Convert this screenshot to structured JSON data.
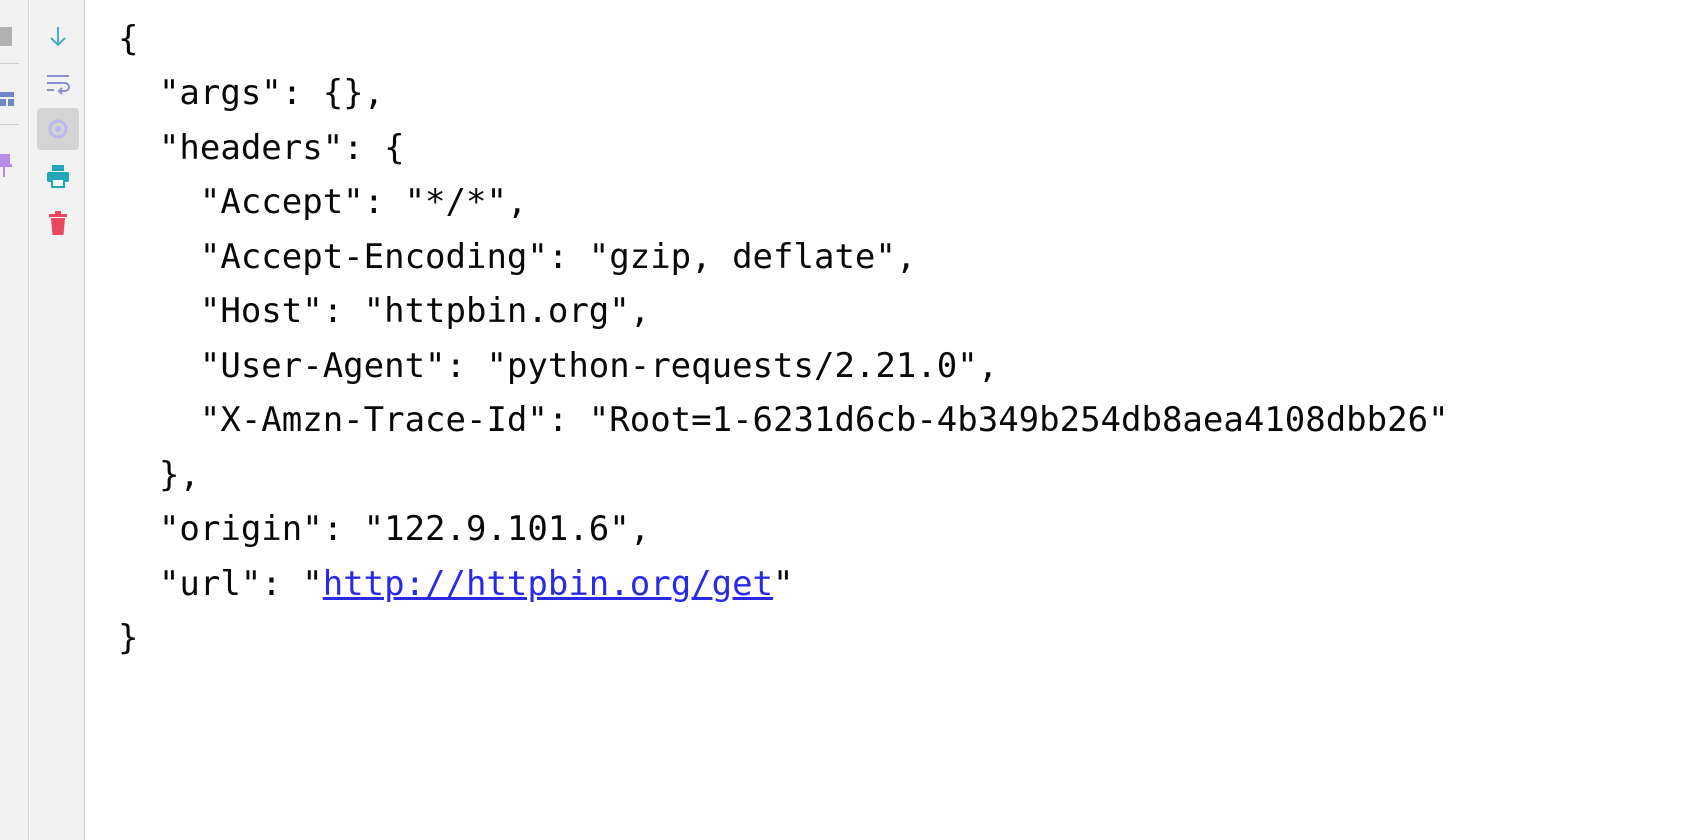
{
  "left_strip": {
    "icons": [
      "square-icon",
      "layout-icon",
      "pin-icon"
    ]
  },
  "toolbar": {
    "buttons": [
      {
        "name": "scroll-to-end-button",
        "icon": "arrow-down-icon",
        "color": "#4aa8c6",
        "active": false
      },
      {
        "name": "soft-wrap-button",
        "icon": "soft-wrap-icon",
        "color": "#8a8fd6",
        "active": false
      },
      {
        "name": "settings-button",
        "icon": "gear-icon",
        "color": "#b9b9ee",
        "active": true
      },
      {
        "name": "print-button",
        "icon": "print-icon",
        "color": "#22a7b8",
        "active": false
      },
      {
        "name": "clear-all-button",
        "icon": "trash-icon",
        "color": "#e8475f",
        "active": false
      }
    ]
  },
  "console": {
    "lines": [
      "{",
      "  \"args\": {},",
      "  \"headers\": {",
      "    \"Accept\": \"*/*\",",
      "    \"Accept-Encoding\": \"gzip, deflate\",",
      "    \"Host\": \"httpbin.org\",",
      "    \"User-Agent\": \"python-requests/2.21.0\",",
      "    \"X-Amzn-Trace-Id\": \"Root=1-6231d6cb-4b349b254db8aea4108dbb26\"",
      "  },",
      "  \"origin\": \"122.9.101.6\","
    ],
    "url_line": {
      "prefix": "  \"url\": \"",
      "link": "http://httpbin.org/get",
      "suffix": "\""
    },
    "closing": "}",
    "link_color": "#2a2ae6",
    "text_color": "#080808"
  }
}
